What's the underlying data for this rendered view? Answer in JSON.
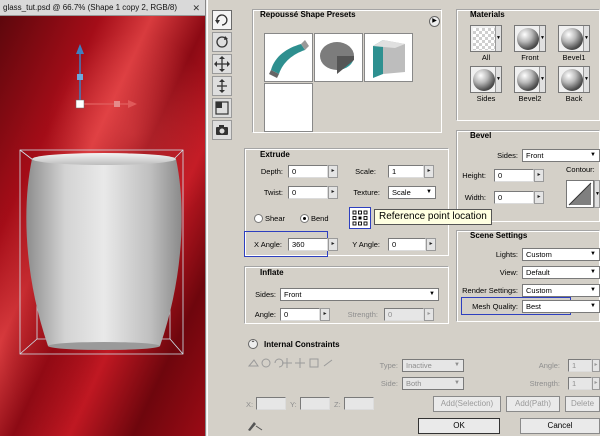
{
  "document": {
    "tab_title": "glass_tut.psd @ 66.7% (Shape 1 copy 2, RGB/8)",
    "close_glyph": "✕"
  },
  "tools": [
    {
      "icon": "rotate-object-icon",
      "active": true
    },
    {
      "icon": "roll-object-icon"
    },
    {
      "icon": "drag-object-icon"
    },
    {
      "icon": "slide-object-icon"
    },
    {
      "icon": "scale-object-icon"
    },
    {
      "icon": "camera-icon"
    }
  ],
  "presets": {
    "title": "Repoussé Shape Presets",
    "menu_glyph": "▶"
  },
  "extrude": {
    "title": "Extrude",
    "depth_label": "Depth:",
    "depth_value": "0",
    "scale_label": "Scale:",
    "scale_value": "1",
    "twist_label": "Twist:",
    "twist_value": "0",
    "texture_label": "Texture:",
    "texture_value": "Scale",
    "shear_label": "Shear",
    "bend_label": "Bend",
    "bend_selected": true,
    "xangle_label": "X Angle:",
    "xangle_value": "360",
    "yangle_label": "Y Angle:",
    "yangle_value": "0"
  },
  "tooltip": "Reference point location",
  "inflate": {
    "title": "Inflate",
    "sides_label": "Sides:",
    "sides_value": "Front",
    "angle_label": "Angle:",
    "angle_value": "0",
    "strength_label": "Strength:",
    "strength_value": "0"
  },
  "constraints": {
    "title": "Internal Constraints",
    "type_label": "Type:",
    "type_value": "Inactive",
    "side_label": "Side:",
    "side_value": "Both",
    "angle_label": "Angle:",
    "angle_value": "1",
    "strength_label": "Strength:",
    "strength_value": "1",
    "x_label": "X:",
    "y_label": "Y:",
    "z_label": "Z:",
    "add_selection": "Add(Selection)",
    "add_path": "Add(Path)",
    "delete": "Delete"
  },
  "materials": {
    "title": "Materials",
    "items": [
      "All",
      "Front",
      "Bevel1",
      "Sides",
      "Bevel2",
      "Back"
    ]
  },
  "bevel": {
    "title": "Bevel",
    "sides_label": "Sides:",
    "sides_value": "Front",
    "height_label": "Height:",
    "height_value": "0",
    "width_label": "Width:",
    "width_value": "0",
    "contour_label": "Contour:"
  },
  "scene": {
    "title": "Scene Settings",
    "lights_label": "Lights:",
    "lights_value": "Custom",
    "view_label": "View:",
    "view_value": "Default",
    "render_label": "Render Settings:",
    "render_value": "Custom",
    "mesh_label": "Mesh Quality:",
    "mesh_value": "Best"
  },
  "buttons": {
    "ok": "OK",
    "cancel": "Cancel"
  },
  "colors": {
    "highlight": "#2d3fbf",
    "canvas_red": "#a40d18",
    "tooltip_bg": "#ffffe1"
  }
}
